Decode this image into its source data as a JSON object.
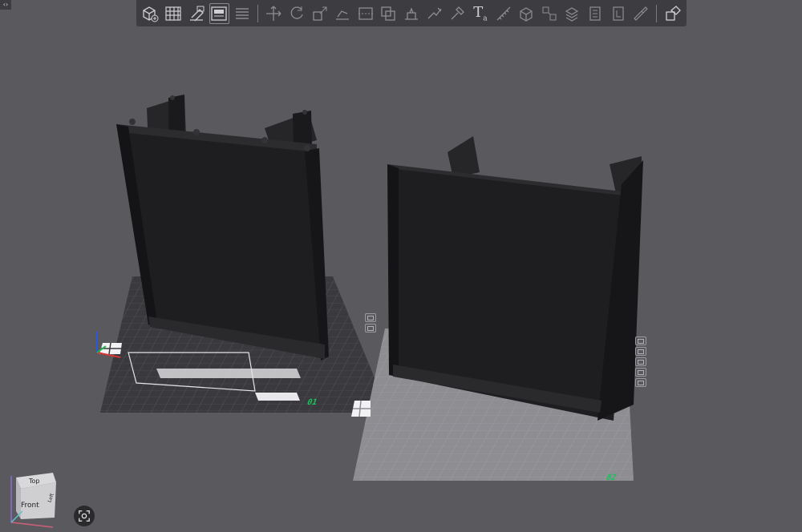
{
  "toolbar": {
    "buttons": [
      {
        "id": "add-object",
        "icon": "cube-plus-icon",
        "active": false
      },
      {
        "id": "arrange",
        "icon": "grid-icon",
        "active": false
      },
      {
        "id": "auto-orient",
        "icon": "orient-icon",
        "active": false
      },
      {
        "id": "add-plate",
        "icon": "plate-icon",
        "active": true
      },
      {
        "id": "layers",
        "icon": "layers-icon",
        "active": false
      },
      {
        "id": "move",
        "icon": "move-icon",
        "active": false
      },
      {
        "id": "rotate",
        "icon": "rotate-icon",
        "active": false
      },
      {
        "id": "scale",
        "icon": "scale-icon",
        "active": false
      },
      {
        "id": "lay-on-face",
        "icon": "lay-face-icon",
        "active": false
      },
      {
        "id": "cut",
        "icon": "cut-icon",
        "active": false
      },
      {
        "id": "mesh-boolean",
        "icon": "boolean-icon",
        "active": false
      },
      {
        "id": "support-paint",
        "icon": "support-paint-icon",
        "active": false
      },
      {
        "id": "seam-paint",
        "icon": "seam-paint-icon",
        "active": false
      },
      {
        "id": "color-paint",
        "icon": "paint-icon",
        "active": false
      },
      {
        "id": "text-shape",
        "icon": "text-icon",
        "active": false
      },
      {
        "id": "measure",
        "icon": "measure-icon",
        "active": false
      },
      {
        "id": "assemble",
        "icon": "assemble-icon",
        "active": false
      },
      {
        "id": "split-objects",
        "icon": "split-objects-icon",
        "active": false
      },
      {
        "id": "split-parts",
        "icon": "split-parts-icon",
        "active": false
      },
      {
        "id": "variable-layer",
        "icon": "variable-layer-icon",
        "active": false
      },
      {
        "id": "fix-model",
        "icon": "fix-icon",
        "active": false
      },
      {
        "id": "simplify",
        "icon": "simplify-icon",
        "active": false
      },
      {
        "id": "emboss",
        "icon": "emboss-icon",
        "active": false
      },
      {
        "id": "explode",
        "icon": "explode-icon",
        "active": false
      }
    ],
    "text_glyph": "T",
    "text_glyph_sub": "a"
  },
  "plates": [
    {
      "label": "01",
      "state": "active",
      "objects": 1
    },
    {
      "label": "02",
      "state": "inactive",
      "objects": 1
    }
  ],
  "view_cube": {
    "top": "Top",
    "front": "Front",
    "left": "Left"
  },
  "colors": {
    "background": "#5a595e",
    "toolbar": "#3d3d41",
    "plate_active": "#3a3a3e",
    "plate_inactive": "#8e8d92",
    "plate_label": "#19c25a",
    "model": "#1f1f21"
  }
}
